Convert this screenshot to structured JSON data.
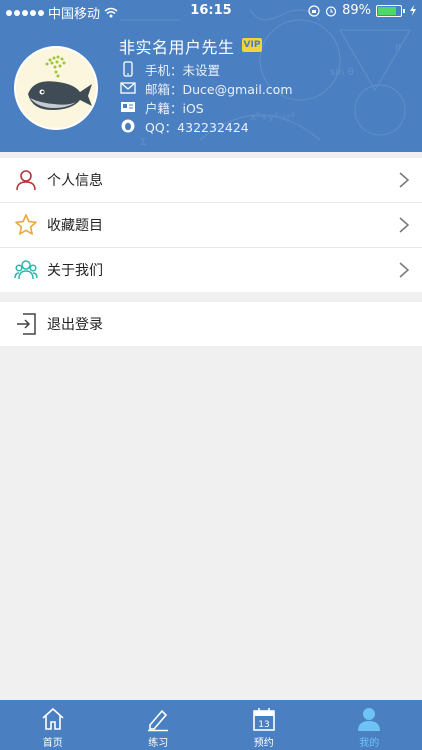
{
  "status_bar": {
    "carrier": "中国移动",
    "time": "16:15",
    "battery": "89%",
    "battery_level": 0.89
  },
  "profile": {
    "username": "非实名用户先生",
    "vip": "VIP",
    "phone": "手机：未设置",
    "email": "邮箱：Duce@gmail.com",
    "hometown": "户籍：iOS",
    "qq": "QQ：432232424"
  },
  "menu": {
    "items": [
      {
        "label": "个人信息",
        "icon": "person-icon",
        "color": "#b2343b"
      },
      {
        "label": "收藏题目",
        "icon": "star-icon",
        "color": "#e8a93a"
      },
      {
        "label": "关于我们",
        "icon": "group-icon",
        "color": "#2fb6a9"
      }
    ],
    "logout": {
      "label": "退出登录",
      "icon": "logout-icon"
    }
  },
  "tabbar": {
    "tabs": [
      {
        "label": "首页",
        "icon": "home-icon"
      },
      {
        "label": "练习",
        "icon": "pencil-icon"
      },
      {
        "label": "预约",
        "icon": "calendar-icon",
        "day": "13"
      },
      {
        "label": "我的",
        "icon": "user-icon",
        "active": true
      }
    ]
  },
  "colors": {
    "primary": "#4a7fc1",
    "active_tab": "#6ec3f4",
    "background": "#f0f0f0"
  }
}
